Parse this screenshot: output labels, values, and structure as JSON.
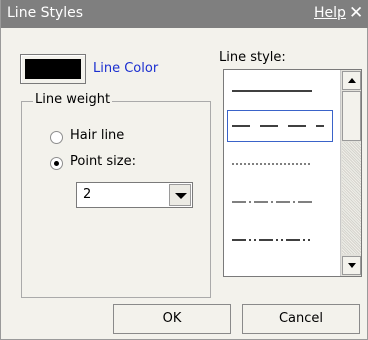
{
  "dialog": {
    "title": "Line Styles",
    "help_label": "Help",
    "close_glyph": "✕"
  },
  "line_color": {
    "label": "Line Color",
    "color": "#000000"
  },
  "line_weight": {
    "group_label": "Line weight",
    "options": [
      {
        "label": "Hair line",
        "checked": false
      },
      {
        "label": "Point size:",
        "checked": true
      }
    ],
    "point_size_value": "2"
  },
  "line_style": {
    "label": "Line style:",
    "items": [
      {
        "name": "solid",
        "selected": false
      },
      {
        "name": "dashed",
        "selected": true
      },
      {
        "name": "dotted",
        "selected": false
      },
      {
        "name": "dash-dot",
        "selected": false
      },
      {
        "name": "dash-dot-dot",
        "selected": false
      }
    ]
  },
  "buttons": {
    "ok_label": "OK",
    "cancel_label": "Cancel"
  }
}
